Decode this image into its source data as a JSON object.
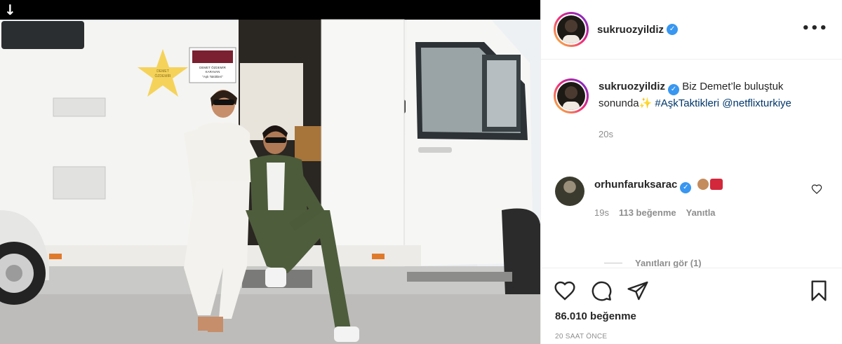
{
  "post": {
    "username": "sukruozyildiz",
    "verified_glyph": "✓",
    "more_glyph": "•••",
    "caption_text": "Biz Demet’le buluştuk sonunda",
    "caption_emoji": "✨",
    "hashtag": "#AşkTaktikleri",
    "mention": "@netflixturkiye",
    "caption_time": "20s",
    "likes": "86.010 beğenme",
    "posted": "20 SAAT ÖNCE"
  },
  "comment": {
    "username": "orhunfaruksarac",
    "time": "19s",
    "likes": "113 beğenme",
    "reply_label": "Yanıtla",
    "view_replies": "Yanıtları gör (1)"
  },
  "image": {
    "download_glyph": "↓",
    "star_text_1": "DEMET",
    "star_text_2": "ÖZDEMİR",
    "sign_text_1": "DEMET ÖZDEMİR",
    "sign_text_2": "KARAVAN",
    "sign_text_3": "\"Aşk Taktikleri\""
  },
  "icons": {
    "like": "heart-icon",
    "comment": "comment-icon",
    "share": "paper-plane-icon",
    "save": "bookmark-icon",
    "comment_like": "heart-icon",
    "options": "more-options-icon",
    "download": "download-arrow-icon"
  },
  "colors": {
    "verified": "#3897f0",
    "link": "#00376b",
    "muted": "#8e8e8e",
    "text": "#262626"
  }
}
